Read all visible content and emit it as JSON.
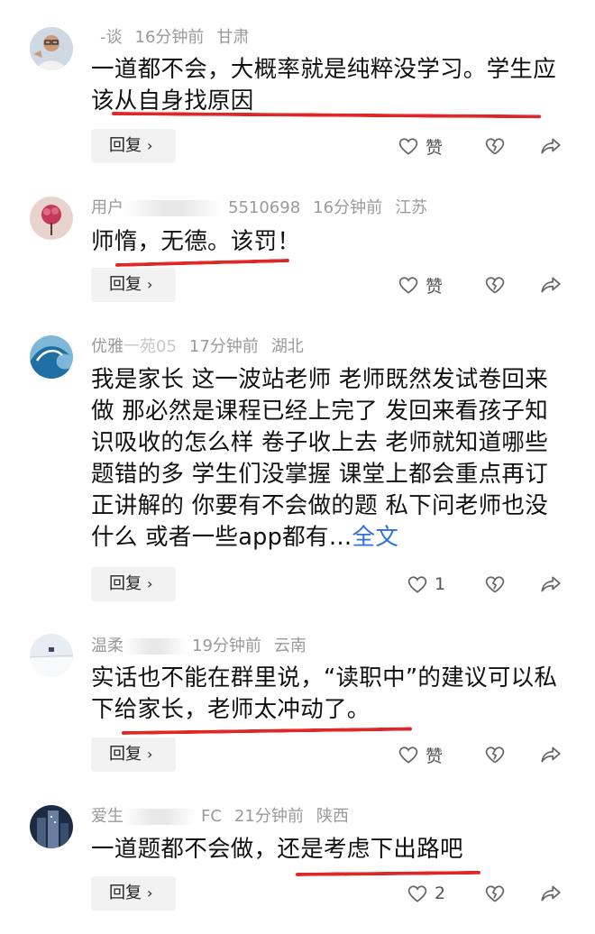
{
  "comments": [
    {
      "name": "-谈",
      "time": "16分钟前",
      "location": "甘肃",
      "text": "一道都不会，大概率就是纯粹没学习。学生应该从自身找原因",
      "reply_label": "回复",
      "like_label": "赞",
      "avatar": "man-glasses-avatar"
    },
    {
      "name": "用户",
      "name_tail": "5510698",
      "time": "16分钟前",
      "location": "江苏",
      "text": "师惰，无德。该罚！",
      "reply_label": "回复",
      "like_label": "赞",
      "avatar": "pink-flower-avatar"
    },
    {
      "name": "优雅",
      "name_tail": "一苑05",
      "time": "17分钟前",
      "location": "湖北",
      "text": "我是家长 这一波站老师 老师既然发试卷回来做 那必然是课程已经上完了 发回来看孩子知识吸收的怎么样 卷子收上去 老师就知道哪些题错的多 学生们没掌握 课堂上都会重点再订正讲解的 你要有不会做的题 私下问老师也没什么 或者一些app都有…",
      "full_text_link": "全文",
      "reply_label": "回复",
      "like_count": "1",
      "avatar": "ocean-wave-avatar"
    },
    {
      "name": "温柔",
      "time": "19分钟前",
      "location": "云南",
      "text": "实话也不能在群里说，“读职中”的建议可以私下给家长，老师太冲动了。",
      "reply_label": "回复",
      "like_label": "赞",
      "avatar": "snow-landscape-avatar"
    },
    {
      "name": "爱生",
      "name_tail": "FC",
      "time": "21分钟前",
      "location": "陕西",
      "text": "一道题都不会做，还是考虑下出路吧",
      "reply_label": "回复",
      "like_count": "2",
      "avatar": "city-building-avatar"
    }
  ],
  "colors": {
    "annotation_red": "#e12626",
    "link_blue": "#2f6fe0",
    "meta_gray": "#9a9a9a"
  }
}
